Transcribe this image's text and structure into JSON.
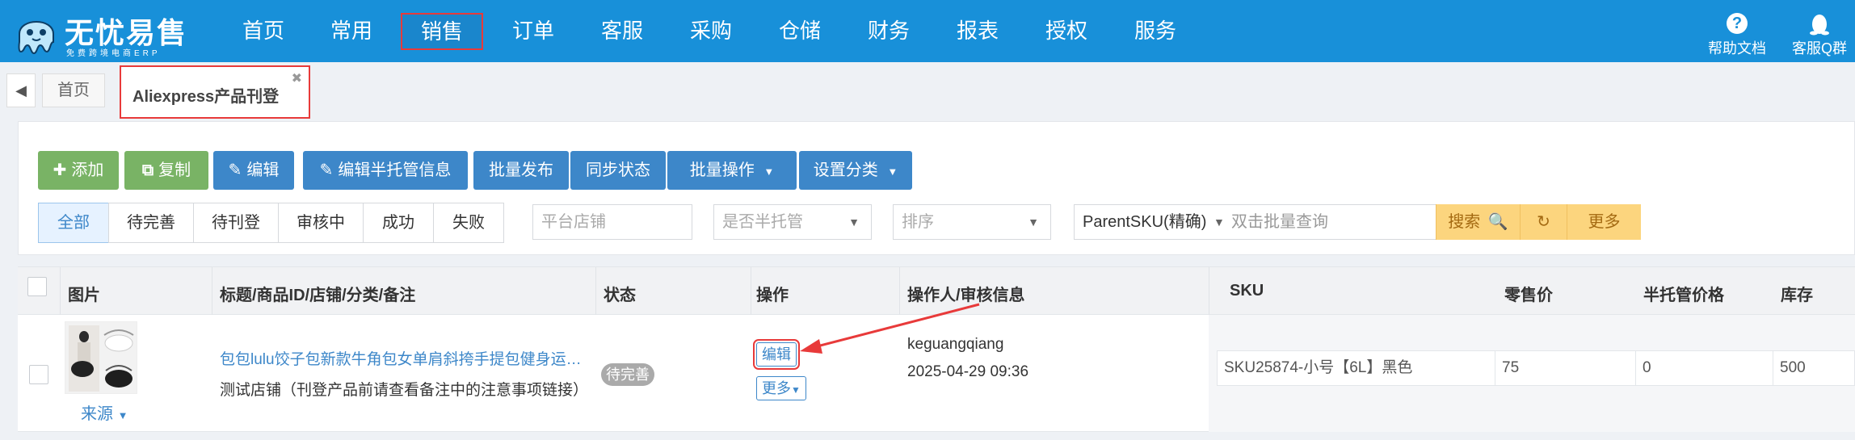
{
  "app": {
    "logo_title": "无忧易售",
    "logo_sub": "免费跨境电商ERP"
  },
  "nav": {
    "items": [
      {
        "label": "首页"
      },
      {
        "label": "常用"
      },
      {
        "label": "销售"
      },
      {
        "label": "订单"
      },
      {
        "label": "客服"
      },
      {
        "label": "采购"
      },
      {
        "label": "仓储"
      },
      {
        "label": "财务"
      },
      {
        "label": "报表"
      },
      {
        "label": "授权"
      },
      {
        "label": "服务"
      }
    ],
    "active": "销售",
    "help_label": "帮助文档",
    "qq_label": "客服Q群"
  },
  "tabs": {
    "home_label": "首页",
    "active_label": "Aliexpress产品刊登"
  },
  "toolbar": {
    "buttons": [
      {
        "label": "添加",
        "icon": "plus-icon"
      },
      {
        "label": "复制",
        "icon": "copy-icon"
      },
      {
        "label": "编辑",
        "icon": "edit-icon"
      },
      {
        "label": "编辑半托管信息",
        "icon": "edit-icon"
      },
      {
        "label": "批量发布"
      },
      {
        "label": "同步状态"
      },
      {
        "label": "批量操作",
        "icon": "chevron-down-icon"
      },
      {
        "label": "设置分类",
        "icon": "chevron-down-icon"
      }
    ]
  },
  "status_tabs": [
    "全部",
    "待完善",
    "待刊登",
    "审核中",
    "成功",
    "失败"
  ],
  "filters": {
    "shop_placeholder": "平台店铺",
    "semi_managed_placeholder": "是否半托管",
    "sort_placeholder": "排序",
    "sku_field_value": "ParentSKU(精确)",
    "sku_query_placeholder": "双击批量查询",
    "search_label": "搜索",
    "more_label": "更多"
  },
  "table": {
    "headers": {
      "image": "图片",
      "title": "标题/商品ID/店铺/分类/备注",
      "status": "状态",
      "action": "操作",
      "operator": "操作人/审核信息",
      "sku": "SKU",
      "price": "零售价",
      "semi_price": "半托管价格",
      "stock": "库存"
    },
    "rows": [
      {
        "source_label": "来源",
        "title": "包包lulu饺子包新款牛角包女单肩斜挎手提包健身运动包",
        "shop_note": "测试店铺（刊登产品前请查看备注中的注意事项链接）",
        "status": "待完善",
        "edit_label": "编辑",
        "more_label": "更多",
        "operator": "keguangqiang",
        "time": "2025-04-29 09:36",
        "sku": "SKU25874-小号【6L】黑色",
        "price": "75",
        "semi_price": "0",
        "stock": "500"
      }
    ]
  },
  "colors": {
    "nav_bg": "#1890d9",
    "btn_green": "#79b365",
    "btn_blue": "#3d87c9",
    "btn_yellow": "#fcd57e",
    "highlight_red": "#e83a3a"
  }
}
